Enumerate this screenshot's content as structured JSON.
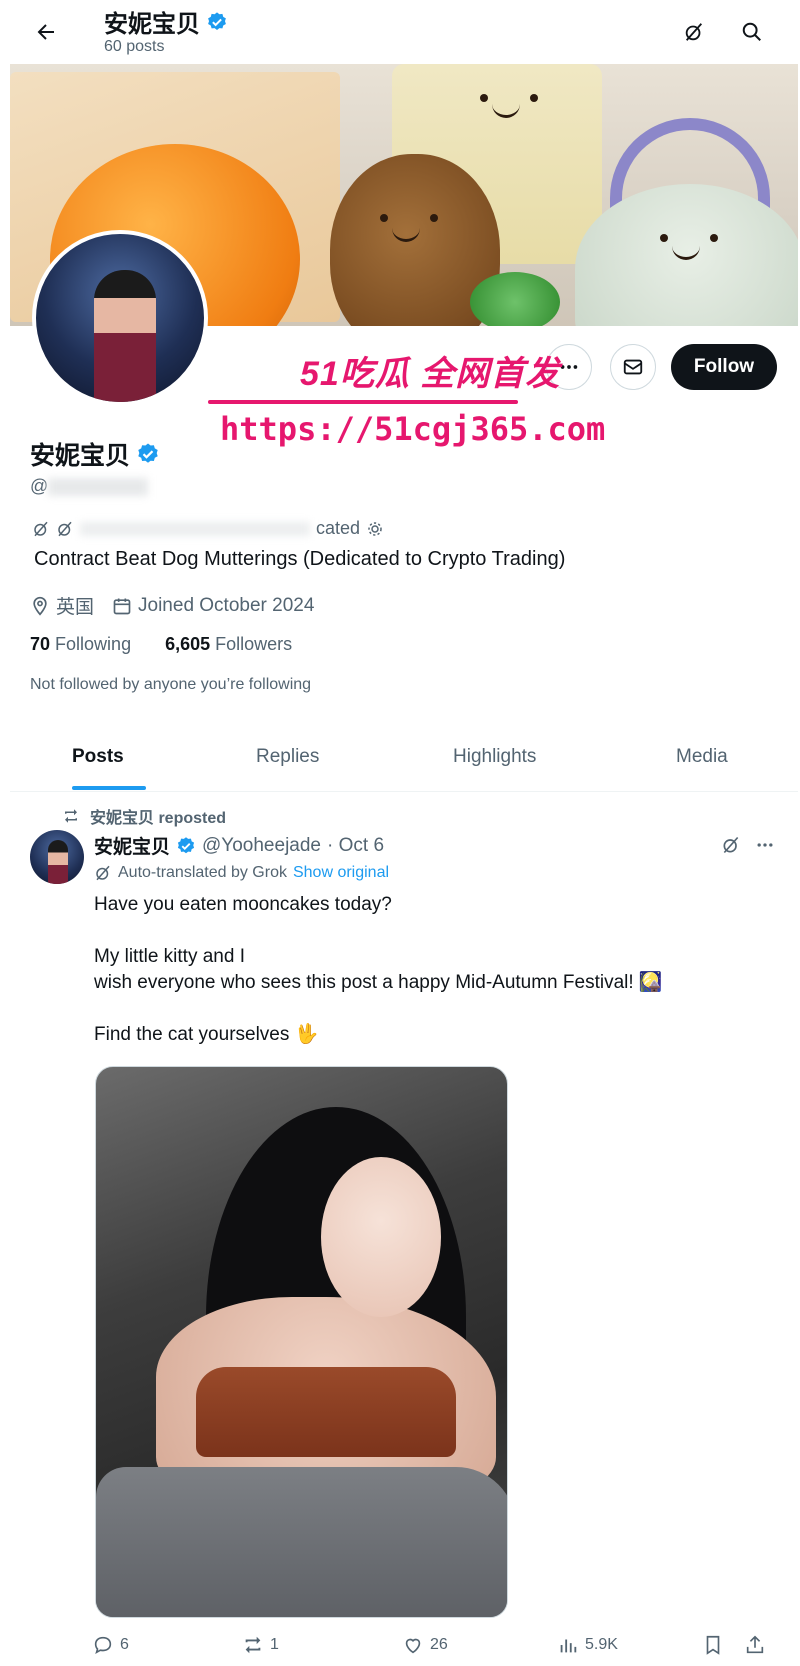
{
  "header": {
    "title": "安妮宝贝",
    "posts_count": "60 posts"
  },
  "profile": {
    "display_name": "安妮宝贝",
    "handle": "@",
    "bio_line1_suffix": "cated",
    "bio": "Contract Beat Dog Mutterings (Dedicated to Crypto Trading)",
    "location": "英国",
    "joined": "Joined October 2024",
    "following_count": "70",
    "following_label": "Following",
    "followers_count": "6,605",
    "followers_label": "Followers",
    "not_followed": "Not followed by anyone you’re following",
    "follow_label": "Follow"
  },
  "watermark": {
    "line1": "51吃瓜 全网首发",
    "line2": "https://51cgj365.com"
  },
  "tabs": [
    {
      "label": "Posts"
    },
    {
      "label": "Replies"
    },
    {
      "label": "Highlights"
    },
    {
      "label": "Media"
    }
  ],
  "post": {
    "repost_label": "安妮宝贝 reposted",
    "author_name": "安妮宝贝",
    "author_handle": "@Yooheejade",
    "date": "· Oct 6",
    "translated_label": "Auto-translated by Grok",
    "show_original": "Show original",
    "text_lines": [
      "Have you eaten mooncakes today?",
      "",
      "My little kitty and I",
      "wish everyone who sees this post a happy Mid-Autumn Festival! 🎑",
      "",
      "Find the cat yourselves 🖖"
    ],
    "replies": "6",
    "reposts": "1",
    "likes": "26",
    "views": "5.9K"
  },
  "colors": {
    "accent": "#1d9bf0",
    "text": "#0f1419",
    "muted": "#536471",
    "watermark": "#e6176e"
  },
  "icons": [
    "back-arrow-icon",
    "grok-icon",
    "search-icon",
    "verified-icon",
    "more-icon",
    "mail-icon",
    "location-icon",
    "calendar-icon",
    "repost-icon",
    "reply-icon",
    "like-icon",
    "views-icon",
    "bookmark-icon",
    "share-icon"
  ]
}
